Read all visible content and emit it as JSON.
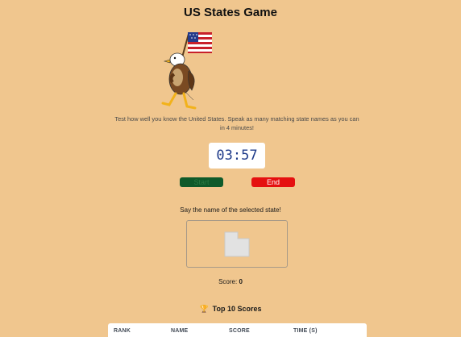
{
  "header": {
    "title": "US States Game"
  },
  "mascot": {
    "icon": "eagle-with-flag-icon"
  },
  "intro": {
    "text": "Test how well you know the United States. Speak as many matching state names as you can in 4 minutes!"
  },
  "timer": {
    "value": "03:57"
  },
  "controls": {
    "start_label": "Start",
    "end_label": "End"
  },
  "game": {
    "prompt": "Say the name of the selected state!",
    "score_label": "Score:",
    "score_value": "0"
  },
  "leaderboard": {
    "title": "Top 10 Scores",
    "icon": "trophy-icon",
    "columns": [
      "RANK",
      "NAME",
      "SCORE",
      "TIME (S)"
    ]
  },
  "colors": {
    "background": "#f0c68e",
    "start_button": "#0f5a2a",
    "end_button": "#e51010",
    "timer_text": "#1f3b8a"
  }
}
